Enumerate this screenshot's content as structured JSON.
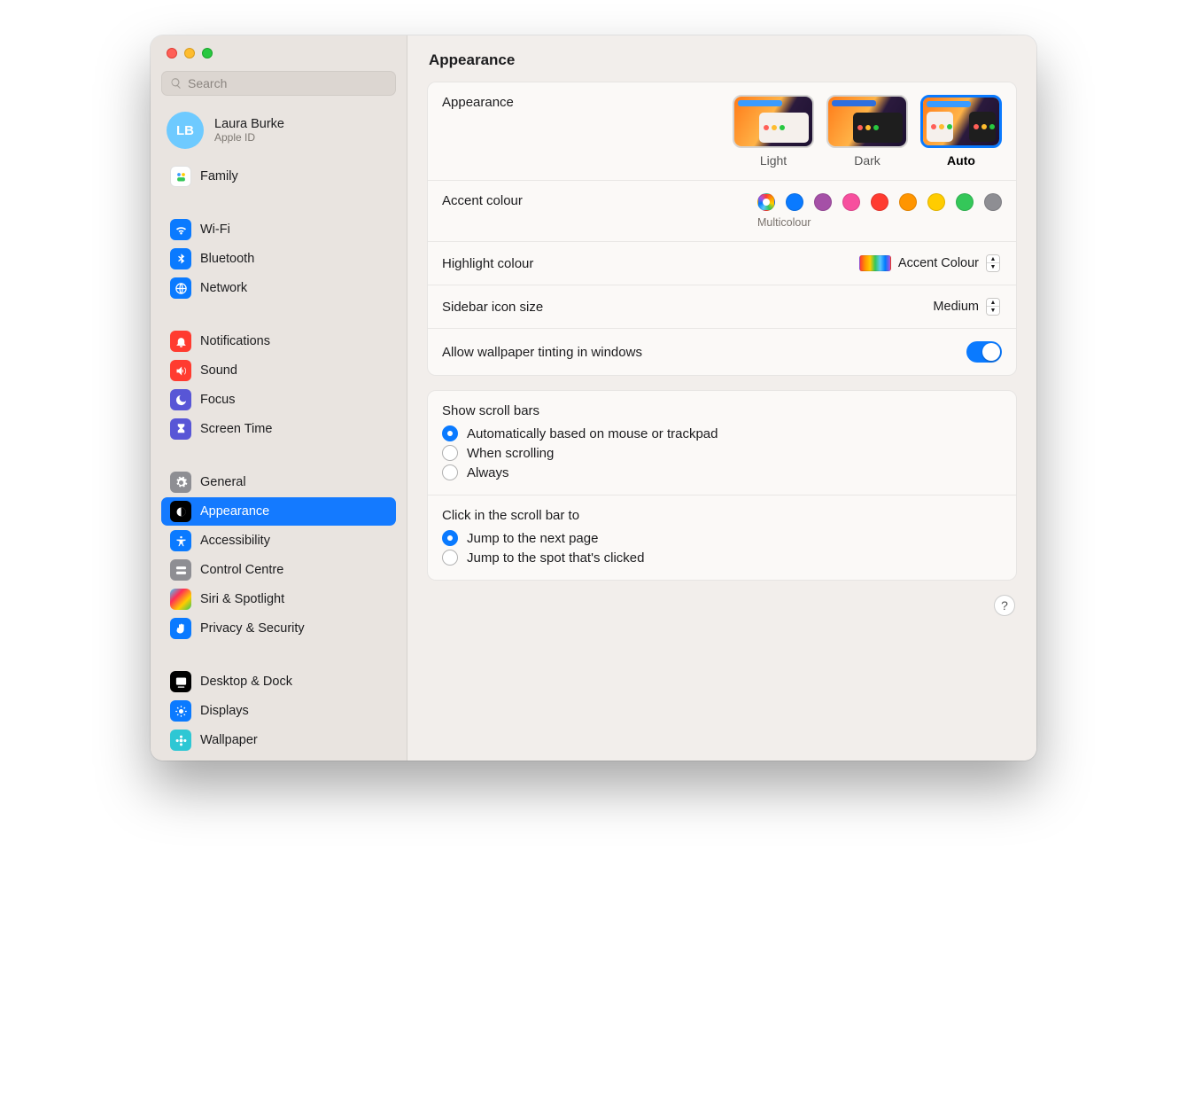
{
  "window": {
    "title": "Appearance"
  },
  "account": {
    "initials": "LB",
    "name": "Laura Burke",
    "sub": "Apple ID"
  },
  "search": {
    "placeholder": "Search"
  },
  "sidebar": {
    "groups": [
      {
        "items": [
          {
            "id": "family",
            "label": "Family"
          }
        ]
      },
      {
        "items": [
          {
            "id": "wifi",
            "label": "Wi-Fi"
          },
          {
            "id": "bluetooth",
            "label": "Bluetooth"
          },
          {
            "id": "network",
            "label": "Network"
          }
        ]
      },
      {
        "items": [
          {
            "id": "notifications",
            "label": "Notifications"
          },
          {
            "id": "sound",
            "label": "Sound"
          },
          {
            "id": "focus",
            "label": "Focus"
          },
          {
            "id": "screentime",
            "label": "Screen Time"
          }
        ]
      },
      {
        "items": [
          {
            "id": "general",
            "label": "General"
          },
          {
            "id": "appearance",
            "label": "Appearance",
            "selected": true
          },
          {
            "id": "accessibility",
            "label": "Accessibility"
          },
          {
            "id": "controlcentre",
            "label": "Control Centre"
          },
          {
            "id": "siri",
            "label": "Siri & Spotlight"
          },
          {
            "id": "privacy",
            "label": "Privacy & Security"
          }
        ]
      },
      {
        "items": [
          {
            "id": "desktopdock",
            "label": "Desktop & Dock"
          },
          {
            "id": "displays",
            "label": "Displays"
          },
          {
            "id": "wallpaper",
            "label": "Wallpaper"
          }
        ]
      }
    ]
  },
  "appearance": {
    "section_label": "Appearance",
    "modes": [
      {
        "id": "light",
        "label": "Light"
      },
      {
        "id": "dark",
        "label": "Dark"
      },
      {
        "id": "auto",
        "label": "Auto",
        "selected": true
      }
    ]
  },
  "accent": {
    "label": "Accent colour",
    "selected_label": "Multicolour",
    "colours": [
      {
        "id": "multi",
        "value": "conic",
        "selected": true
      },
      {
        "id": "blue",
        "value": "#0a7aff"
      },
      {
        "id": "purple",
        "value": "#a550a7"
      },
      {
        "id": "pink",
        "value": "#f74f9e"
      },
      {
        "id": "red",
        "value": "#ff3b30"
      },
      {
        "id": "orange",
        "value": "#ff9500"
      },
      {
        "id": "yellow",
        "value": "#ffcc00"
      },
      {
        "id": "green",
        "value": "#34c759"
      },
      {
        "id": "graphite",
        "value": "#8e8e93"
      }
    ]
  },
  "highlight": {
    "label": "Highlight colour",
    "value": "Accent Colour"
  },
  "sidebar_size": {
    "label": "Sidebar icon size",
    "value": "Medium"
  },
  "tinting": {
    "label": "Allow wallpaper tinting in windows",
    "on": true
  },
  "scrollbars": {
    "title": "Show scroll bars",
    "options": [
      {
        "label": "Automatically based on mouse or trackpad",
        "checked": true
      },
      {
        "label": "When scrolling"
      },
      {
        "label": "Always"
      }
    ]
  },
  "click_scroll": {
    "title": "Click in the scroll bar to",
    "options": [
      {
        "label": "Jump to the next page",
        "checked": true
      },
      {
        "label": "Jump to the spot that's clicked"
      }
    ]
  },
  "help": {
    "glyph": "?"
  }
}
